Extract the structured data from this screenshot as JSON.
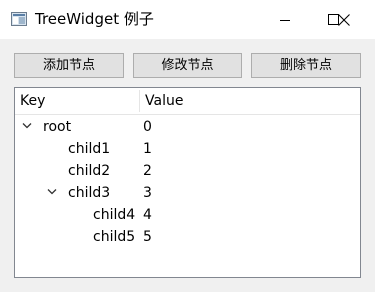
{
  "window": {
    "title": "TreeWidget 例子",
    "icon": "app-window-icon",
    "controls": [
      "minimize-icon",
      "maximize-icon",
      "close-icon"
    ]
  },
  "toolbar": {
    "add_label": "添加节点",
    "edit_label": "修改节点",
    "delete_label": "删除节点"
  },
  "tree": {
    "headers": {
      "key": "Key",
      "value": "Value"
    },
    "rows": [
      {
        "key": "root",
        "value": "0",
        "depth": 0,
        "expanded": true
      },
      {
        "key": "child1",
        "value": "1",
        "depth": 1,
        "expanded": null
      },
      {
        "key": "child2",
        "value": "2",
        "depth": 1,
        "expanded": null
      },
      {
        "key": "child3",
        "value": "3",
        "depth": 1,
        "expanded": true
      },
      {
        "key": "child4",
        "value": "4",
        "depth": 2,
        "expanded": null
      },
      {
        "key": "child5",
        "value": "5",
        "depth": 2,
        "expanded": null
      }
    ]
  }
}
